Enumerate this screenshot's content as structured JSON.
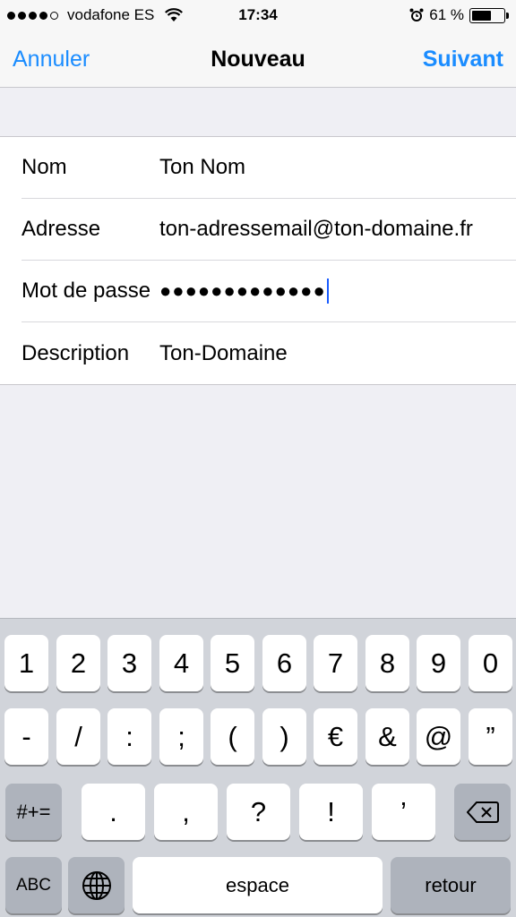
{
  "status": {
    "carrier": "vodafone ES",
    "time": "17:34",
    "battery": "61 %",
    "battery_level": 0.61
  },
  "nav": {
    "cancel": "Annuler",
    "title": "Nouveau",
    "next": "Suivant"
  },
  "form": {
    "rows": [
      {
        "label": "Nom",
        "value": "Ton Nom"
      },
      {
        "label": "Adresse",
        "value": "ton-adressemail@ton-domaine.fr"
      },
      {
        "label": "Mot de passe",
        "value": "●●●●●●●●●●●●●"
      },
      {
        "label": "Description",
        "value": "Ton-Domaine"
      }
    ]
  },
  "keyboard": {
    "row1": [
      "1",
      "2",
      "3",
      "4",
      "5",
      "6",
      "7",
      "8",
      "9",
      "0"
    ],
    "row2": [
      "-",
      "/",
      ":",
      ";",
      "(",
      ")",
      "€",
      "&",
      "@",
      "”"
    ],
    "row3": [
      ".",
      ",",
      "?",
      "!",
      "’"
    ],
    "symbols_toggle": "#+=",
    "abc": "ABC",
    "space": "espace",
    "return": "retour"
  }
}
